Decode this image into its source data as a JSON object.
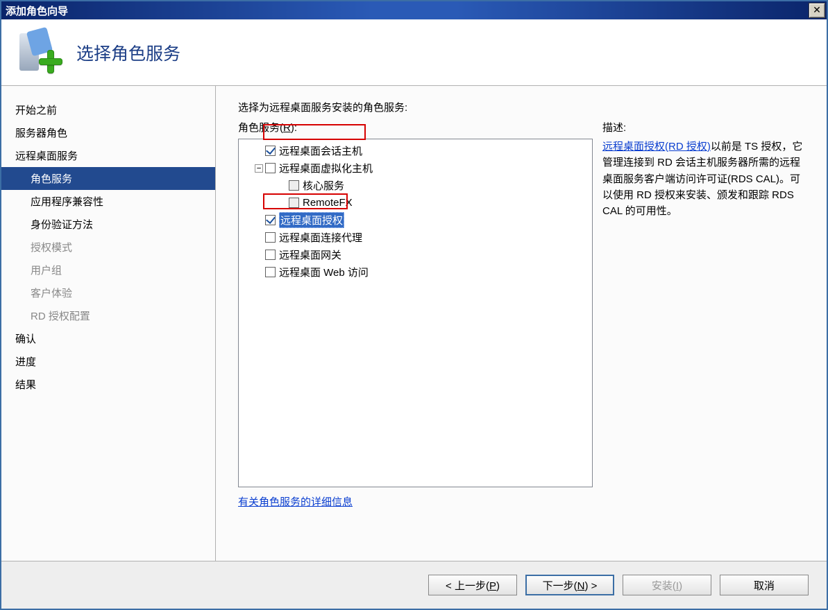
{
  "window": {
    "title": "添加角色向导"
  },
  "header": {
    "heading": "选择角色服务"
  },
  "sidebar": {
    "items": [
      {
        "label": "开始之前",
        "level": 0,
        "selected": false,
        "disabled": false
      },
      {
        "label": "服务器角色",
        "level": 0,
        "selected": false,
        "disabled": false
      },
      {
        "label": "远程桌面服务",
        "level": 0,
        "selected": false,
        "disabled": false
      },
      {
        "label": "角色服务",
        "level": 1,
        "selected": true,
        "disabled": false
      },
      {
        "label": "应用程序兼容性",
        "level": 1,
        "selected": false,
        "disabled": false
      },
      {
        "label": "身份验证方法",
        "level": 1,
        "selected": false,
        "disabled": false
      },
      {
        "label": "授权模式",
        "level": 1,
        "selected": false,
        "disabled": true
      },
      {
        "label": "用户组",
        "level": 1,
        "selected": false,
        "disabled": true
      },
      {
        "label": "客户体验",
        "level": 1,
        "selected": false,
        "disabled": true
      },
      {
        "label": "RD 授权配置",
        "level": 1,
        "selected": false,
        "disabled": true
      },
      {
        "label": "确认",
        "level": 0,
        "selected": false,
        "disabled": false
      },
      {
        "label": "进度",
        "level": 0,
        "selected": false,
        "disabled": false
      },
      {
        "label": "结果",
        "level": 0,
        "selected": false,
        "disabled": false
      }
    ]
  },
  "content": {
    "instruction": "选择为远程桌面服务安装的角色服务:",
    "services_label_prefix": "角色服务(",
    "services_hotkey": "R",
    "services_label_suffix": "):",
    "tree": [
      {
        "label": "远程桌面会话主机",
        "checked": true,
        "indent": 36,
        "expander": null,
        "selected": false,
        "callout": true
      },
      {
        "label": "远程桌面虚拟化主机",
        "checked": false,
        "indent": 36,
        "expander": "−",
        "selected": false,
        "callout": false
      },
      {
        "label": "核心服务",
        "checked": false,
        "indent": 70,
        "expander": null,
        "selected": false,
        "callout": false,
        "disabled": true
      },
      {
        "label": "RemoteFX",
        "checked": false,
        "indent": 70,
        "expander": null,
        "selected": false,
        "callout": false,
        "disabled": true
      },
      {
        "label": "远程桌面授权",
        "checked": true,
        "indent": 36,
        "expander": null,
        "selected": true,
        "callout": true
      },
      {
        "label": "远程桌面连接代理",
        "checked": false,
        "indent": 36,
        "expander": null,
        "selected": false,
        "callout": false
      },
      {
        "label": "远程桌面网关",
        "checked": false,
        "indent": 36,
        "expander": null,
        "selected": false,
        "callout": false
      },
      {
        "label": "远程桌面 Web 访问",
        "checked": false,
        "indent": 36,
        "expander": null,
        "selected": false,
        "callout": false
      }
    ],
    "more_link": "有关角色服务的详细信息",
    "description": {
      "title": "描述:",
      "link_text": "远程桌面授权(RD 授权)",
      "body_after_link": "以前是 TS 授权，它管理连接到 RD 会话主机服务器所需的远程桌面服务客户端访问许可证(RDS CAL)。可以使用 RD 授权来安装、颁发和跟踪 RDS CAL 的可用性。"
    }
  },
  "footer": {
    "back_prefix": "< 上一步(",
    "back_hk": "P",
    "back_suffix": ")",
    "next_prefix": "下一步(",
    "next_hk": "N",
    "next_suffix": ") >",
    "install_prefix": "安装(",
    "install_hk": "I",
    "install_suffix": ")",
    "cancel": "取消"
  }
}
